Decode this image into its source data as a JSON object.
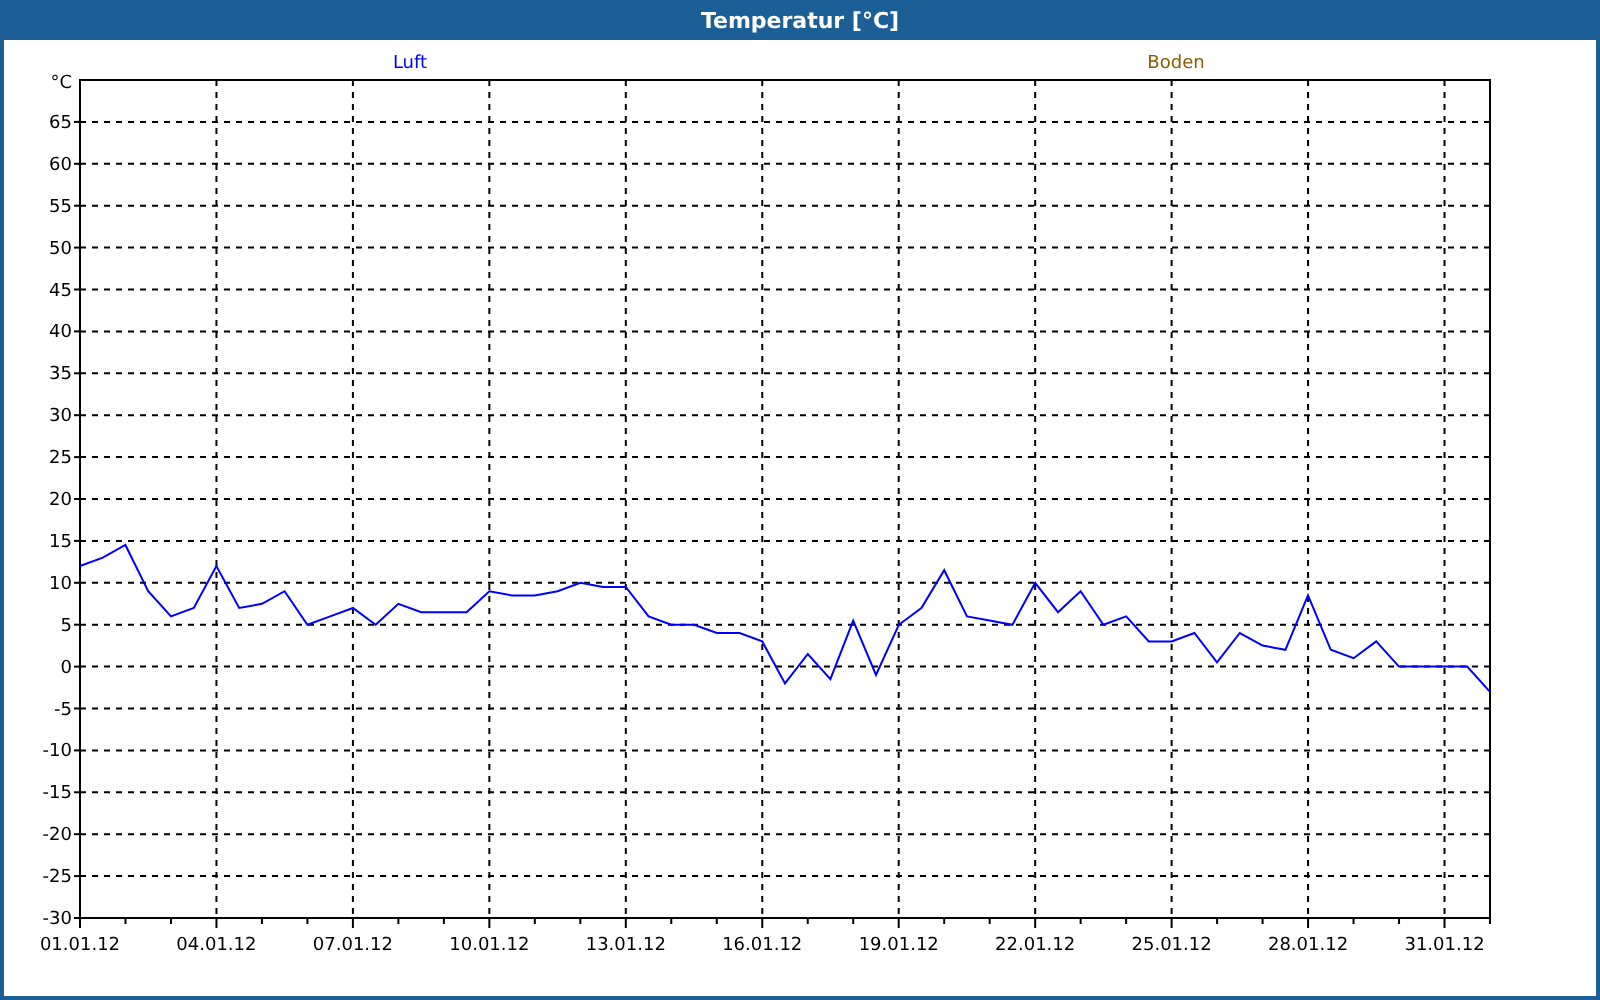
{
  "window": {
    "title": "Temperatur [°C]"
  },
  "chart_data": {
    "type": "line",
    "grid": true,
    "ylabel": "°C",
    "ylim": [
      -30,
      70
    ],
    "categories": [
      "01.01.12",
      null,
      null,
      null,
      null,
      null,
      "04.01.12",
      null,
      null,
      null,
      null,
      null,
      "07.01.12",
      null,
      null,
      null,
      null,
      null,
      "10.01.12",
      null,
      null,
      null,
      null,
      null,
      "13.01.12",
      null,
      null,
      null,
      null,
      null,
      "16.01.12",
      null,
      null,
      null,
      null,
      null,
      "19.01.12",
      null,
      null,
      null,
      null,
      null,
      "22.01.12",
      null,
      null,
      null,
      null,
      null,
      "25.01.12",
      null,
      null,
      null,
      null,
      null,
      "28.01.12",
      null,
      null,
      null,
      null,
      null,
      "31.01.12",
      null,
      null
    ],
    "series": [
      {
        "name": "Luft",
        "color": "#0000ff",
        "values": [
          12,
          13,
          14.5,
          9,
          6,
          7,
          12,
          7,
          7.5,
          9,
          5,
          6,
          7,
          5,
          7.5,
          6.5,
          6.5,
          6.5,
          9,
          8.5,
          8.5,
          9,
          10,
          9.5,
          9.5,
          6,
          5,
          5,
          4,
          4,
          3,
          -2,
          1.5,
          -1.5,
          5.5,
          -1,
          5,
          7,
          11.5,
          6,
          5.5,
          5,
          10,
          6.5,
          9,
          5,
          6,
          3,
          3,
          4,
          0.5,
          4,
          2.5,
          2,
          8.5,
          2,
          1,
          3,
          0,
          0,
          0,
          0,
          -3
        ]
      },
      {
        "name": "Boden",
        "color": "#8b5a00",
        "values": [
          null,
          null,
          null,
          null,
          null,
          null,
          null,
          null,
          null,
          null,
          null,
          null,
          null,
          null,
          null,
          null,
          null,
          null,
          null,
          null,
          null,
          null,
          null,
          null,
          null,
          null,
          null,
          null,
          null,
          null,
          null,
          null,
          null,
          null,
          null,
          null,
          null,
          null,
          null,
          null,
          null,
          null,
          null,
          null,
          null,
          null,
          null,
          null,
          null,
          null,
          null,
          null,
          null,
          null,
          null,
          null,
          null,
          null,
          null,
          null,
          null,
          null,
          null
        ]
      }
    ],
    "yticks": [
      -30,
      -25,
      -20,
      -15,
      -10,
      -5,
      0,
      5,
      10,
      15,
      20,
      25,
      30,
      35,
      40,
      45,
      50,
      55,
      60,
      65
    ]
  }
}
